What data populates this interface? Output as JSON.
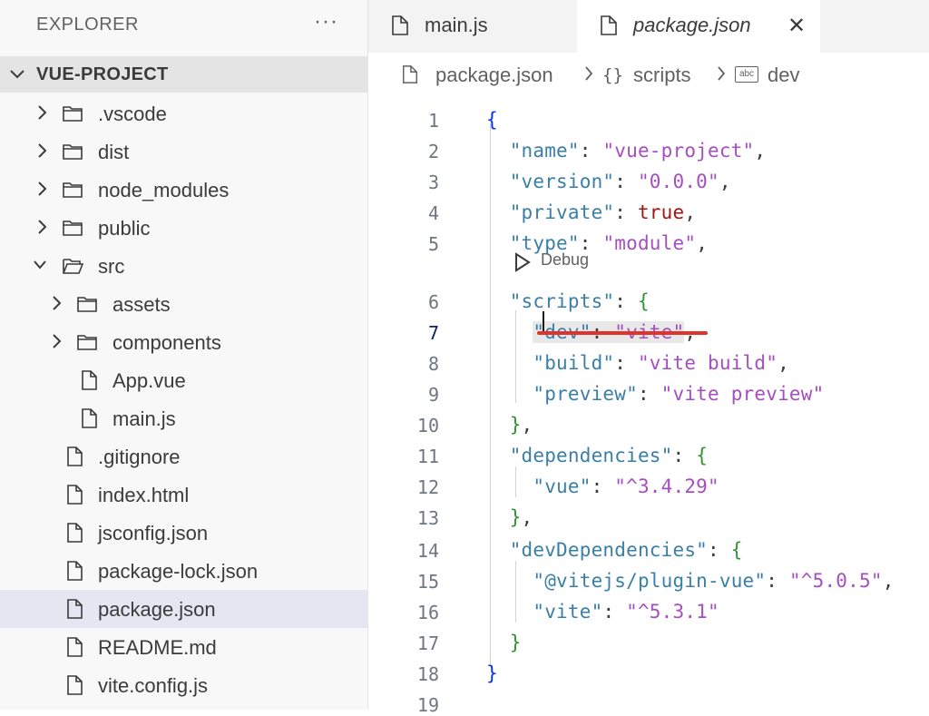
{
  "sidebar": {
    "title": "EXPLORER",
    "more": "···",
    "root_label": "VUE-PROJECT",
    "items": [
      {
        "label": ".vscode",
        "kind": "folder",
        "expanded": false
      },
      {
        "label": "dist",
        "kind": "folder",
        "expanded": false
      },
      {
        "label": "node_modules",
        "kind": "folder",
        "expanded": false
      },
      {
        "label": "public",
        "kind": "folder",
        "expanded": false
      },
      {
        "label": "src",
        "kind": "folder",
        "expanded": true
      },
      {
        "label": "assets",
        "kind": "folder",
        "expanded": false
      },
      {
        "label": "components",
        "kind": "folder",
        "expanded": false
      },
      {
        "label": "App.vue",
        "kind": "file"
      },
      {
        "label": "main.js",
        "kind": "file"
      },
      {
        "label": ".gitignore",
        "kind": "file"
      },
      {
        "label": "index.html",
        "kind": "file"
      },
      {
        "label": "jsconfig.json",
        "kind": "file"
      },
      {
        "label": "package-lock.json",
        "kind": "file"
      },
      {
        "label": "package.json",
        "kind": "file",
        "selected": true
      },
      {
        "label": "README.md",
        "kind": "file"
      },
      {
        "label": "vite.config.js",
        "kind": "file"
      }
    ]
  },
  "tabs": [
    {
      "label": "main.js",
      "active": false
    },
    {
      "label": "package.json",
      "active": true,
      "close": "✕"
    }
  ],
  "breadcrumb": {
    "file": "package.json",
    "scripts_icon": "{}",
    "scripts": "scripts",
    "dev_icon": "abc",
    "dev": "dev"
  },
  "editor": {
    "codelens": "Debug",
    "line_numbers": [
      "1",
      "2",
      "3",
      "4",
      "5",
      "6",
      "7",
      "8",
      "9",
      "10",
      "11",
      "12",
      "13",
      "14",
      "15",
      "16",
      "17",
      "18",
      "19"
    ],
    "current_line": "7",
    "lines": [
      [
        [
          "c-brace",
          "{"
        ]
      ],
      [
        [
          "c-punct",
          "  "
        ],
        [
          "c-key",
          "\"name\""
        ],
        [
          "c-punct",
          ": "
        ],
        [
          "c-str",
          "\"vue-project\""
        ],
        [
          "c-punct",
          ","
        ]
      ],
      [
        [
          "c-punct",
          "  "
        ],
        [
          "c-key",
          "\"version\""
        ],
        [
          "c-punct",
          ": "
        ],
        [
          "c-str",
          "\"0.0.0\""
        ],
        [
          "c-punct",
          ","
        ]
      ],
      [
        [
          "c-punct",
          "  "
        ],
        [
          "c-key",
          "\"private\""
        ],
        [
          "c-punct",
          ": "
        ],
        [
          "c-kw",
          "true"
        ],
        [
          "c-punct",
          ","
        ]
      ],
      [
        [
          "c-punct",
          "  "
        ],
        [
          "c-key",
          "\"type\""
        ],
        [
          "c-punct",
          ": "
        ],
        [
          "c-str",
          "\"module\""
        ],
        [
          "c-punct",
          ","
        ]
      ],
      [
        [
          "c-punct",
          "  "
        ],
        [
          "c-key",
          "\"scripts\""
        ],
        [
          "c-punct",
          ": "
        ],
        [
          "c-brace2",
          "{"
        ]
      ],
      [
        [
          "c-punct",
          "    "
        ],
        [
          "c-key hl",
          "\"dev\""
        ],
        [
          "c-punct hl",
          ": "
        ],
        [
          "c-str hl",
          "\"vite\""
        ],
        [
          "c-punct",
          ","
        ]
      ],
      [
        [
          "c-punct",
          "    "
        ],
        [
          "c-key",
          "\"build\""
        ],
        [
          "c-punct",
          ": "
        ],
        [
          "c-str",
          "\"vite build\""
        ],
        [
          "c-punct",
          ","
        ]
      ],
      [
        [
          "c-punct",
          "    "
        ],
        [
          "c-key",
          "\"preview\""
        ],
        [
          "c-punct",
          ": "
        ],
        [
          "c-str",
          "\"vite preview\""
        ]
      ],
      [
        [
          "c-punct",
          "  "
        ],
        [
          "c-brace2",
          "}"
        ],
        [
          "c-punct",
          ","
        ]
      ],
      [
        [
          "c-punct",
          "  "
        ],
        [
          "c-key",
          "\"dependencies\""
        ],
        [
          "c-punct",
          ": "
        ],
        [
          "c-brace2",
          "{"
        ]
      ],
      [
        [
          "c-punct",
          "    "
        ],
        [
          "c-key",
          "\"vue\""
        ],
        [
          "c-punct",
          ": "
        ],
        [
          "c-str",
          "\"^3.4.29\""
        ]
      ],
      [
        [
          "c-punct",
          "  "
        ],
        [
          "c-brace2",
          "}"
        ],
        [
          "c-punct",
          ","
        ]
      ],
      [
        [
          "c-punct",
          "  "
        ],
        [
          "c-key",
          "\"devDependencies\""
        ],
        [
          "c-punct",
          ": "
        ],
        [
          "c-brace2",
          "{"
        ]
      ],
      [
        [
          "c-punct",
          "    "
        ],
        [
          "c-key",
          "\"@vitejs/plugin-vue\""
        ],
        [
          "c-punct",
          ": "
        ],
        [
          "c-str",
          "\"^5.0.5\""
        ],
        [
          "c-punct",
          ","
        ]
      ],
      [
        [
          "c-punct",
          "    "
        ],
        [
          "c-key",
          "\"vite\""
        ],
        [
          "c-punct",
          ": "
        ],
        [
          "c-str",
          "\"^5.3.1\""
        ]
      ],
      [
        [
          "c-punct",
          "  "
        ],
        [
          "c-brace2",
          "}"
        ]
      ],
      [
        [
          "c-brace",
          "}"
        ]
      ],
      []
    ]
  },
  "colors": {
    "key": "#3a7fa8",
    "string": "#a64ec0",
    "keyword": "#a31515",
    "brace_outer": "#0431fa",
    "brace_inner": "#319331",
    "annotation": "#e0332c",
    "selection": "#e4e6f1"
  }
}
